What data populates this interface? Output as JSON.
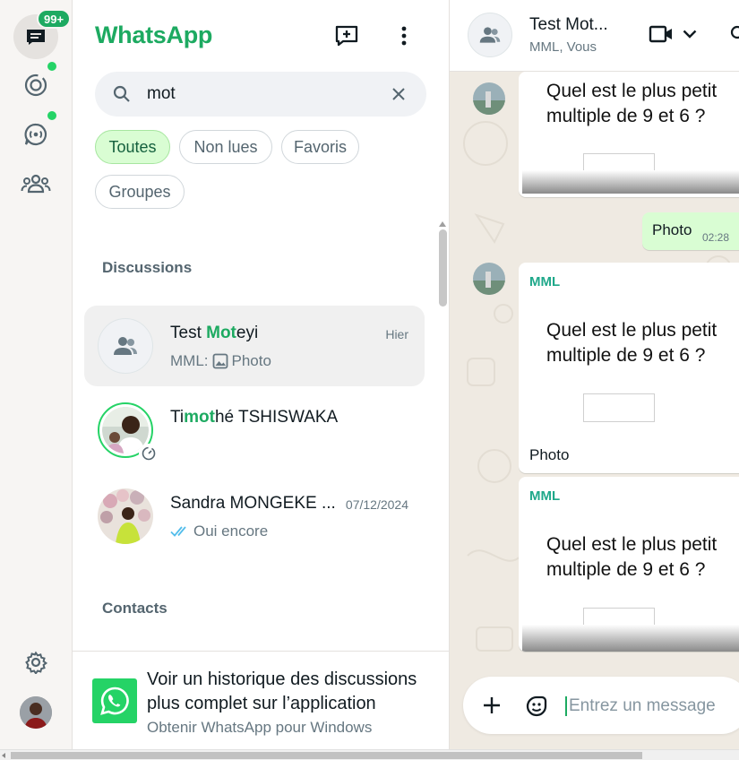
{
  "rail": {
    "badge": "99+"
  },
  "header": {
    "brand": "WhatsApp"
  },
  "search": {
    "query": "mot"
  },
  "filters": {
    "all": "Toutes",
    "unread": "Non lues",
    "favorites": "Favoris",
    "groups": "Groupes"
  },
  "sections": {
    "discussions": "Discussions",
    "contacts": "Contacts"
  },
  "chats": [
    {
      "name_pre": "Test ",
      "name_hl": "Mot",
      "name_post": "eyi",
      "time": "Hier",
      "sender": "MML:",
      "preview": "Photo"
    },
    {
      "name_pre": "Ti",
      "name_hl": "mot",
      "name_post": "hé TSHISWAKA"
    },
    {
      "name": "Sandra MONGEKE ...",
      "time": "07/12/2024",
      "preview": "Oui encore"
    }
  ],
  "promo": {
    "title": "Voir un historique des discussions plus complet sur l’application",
    "link": "Obtenir WhatsApp pour Windows"
  },
  "conversation": {
    "title": "Test Mot...",
    "subtitle": "MML, Vous",
    "messages": [
      {
        "image_text_line1": "Quel est le plus petit",
        "image_text_line2": "multiple de 9 et 6 ?"
      },
      {
        "text": "Photo",
        "time": "02:28"
      },
      {
        "sender": "MML",
        "image_text_line1": "Quel est le plus petit",
        "image_text_line2": "multiple de 9 et 6 ?",
        "caption": "Photo"
      },
      {
        "sender": "MML",
        "image_text_line1": "Quel est le plus petit",
        "image_text_line2": "multiple de 9 et 6 ?"
      }
    ],
    "composer_placeholder": "Entrez un message"
  },
  "colors": {
    "brand": "#1daa61",
    "outgoing_bubble": "#d9fdd3",
    "sender_name": "#1fa88a"
  }
}
